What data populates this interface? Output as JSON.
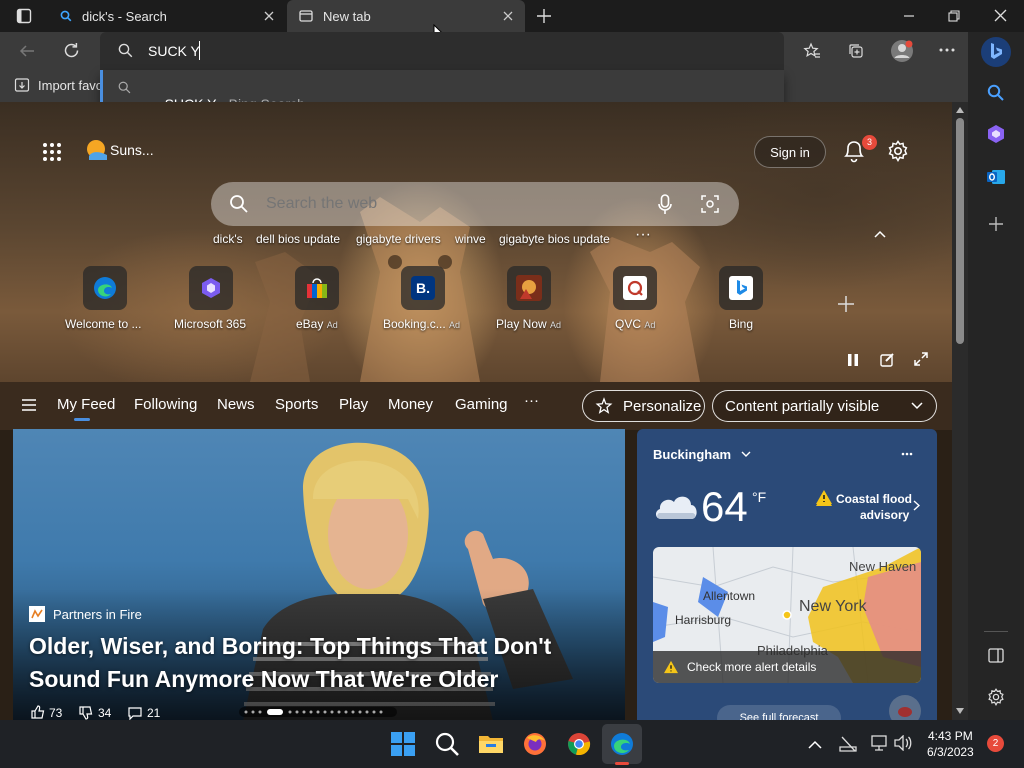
{
  "tabs": [
    {
      "title": "dick's - Search"
    },
    {
      "title": "New tab"
    }
  ],
  "omnibox": {
    "value": "SUCK Y"
  },
  "suggestion": {
    "query": "SUCK Y",
    "suffix": " - Bing Search"
  },
  "bookmarks": {
    "import_label": "Import favo"
  },
  "header": {
    "weather_short": "Suns...",
    "sign_in": "Sign in",
    "notif_count": "3"
  },
  "search": {
    "placeholder": "Search the web"
  },
  "chips": [
    "dick's",
    "dell bios update",
    "gigabyte drivers",
    "winve",
    "gigabyte bios update"
  ],
  "tiles": [
    {
      "label": "Welcome to ...",
      "ad": ""
    },
    {
      "label": "Microsoft 365",
      "ad": ""
    },
    {
      "label": "eBay",
      "ad": "Ad"
    },
    {
      "label": "Booking.c...",
      "ad": "Ad"
    },
    {
      "label": "Play Now",
      "ad": "Ad"
    },
    {
      "label": "QVC",
      "ad": "Ad"
    },
    {
      "label": "Bing",
      "ad": ""
    }
  ],
  "feed_nav": [
    "My Feed",
    "Following",
    "News",
    "Sports",
    "Play",
    "Money",
    "Gaming"
  ],
  "personalize": "Personalize",
  "content_visibility": "Content partially visible",
  "story": {
    "source": "Partners in Fire",
    "headline_line1": "Older, Wiser, and Boring: Top Things That Don't",
    "headline_line2": "Sound Fun Anymore Now That We're Older",
    "likes": "73",
    "dislikes": "34",
    "comments": "21"
  },
  "weather": {
    "location": "Buckingham",
    "temp": "64",
    "unit": "°F",
    "alert_line1": "Coastal flood",
    "alert_line2": "advisory",
    "map_labels": [
      "Allentown",
      "Harrisburg",
      "New York",
      "New Haven",
      "Philadelphia"
    ],
    "alert_details": "Check more alert details",
    "forecast_link": "See full forecast"
  },
  "clock": {
    "time": "4:43 PM",
    "date": "6/3/2023"
  },
  "tray_badge": "2",
  "colors": {
    "accent": "#4a8fe0",
    "edge_blue": "#0f7bd8",
    "notif_red": "#e74a3b"
  }
}
